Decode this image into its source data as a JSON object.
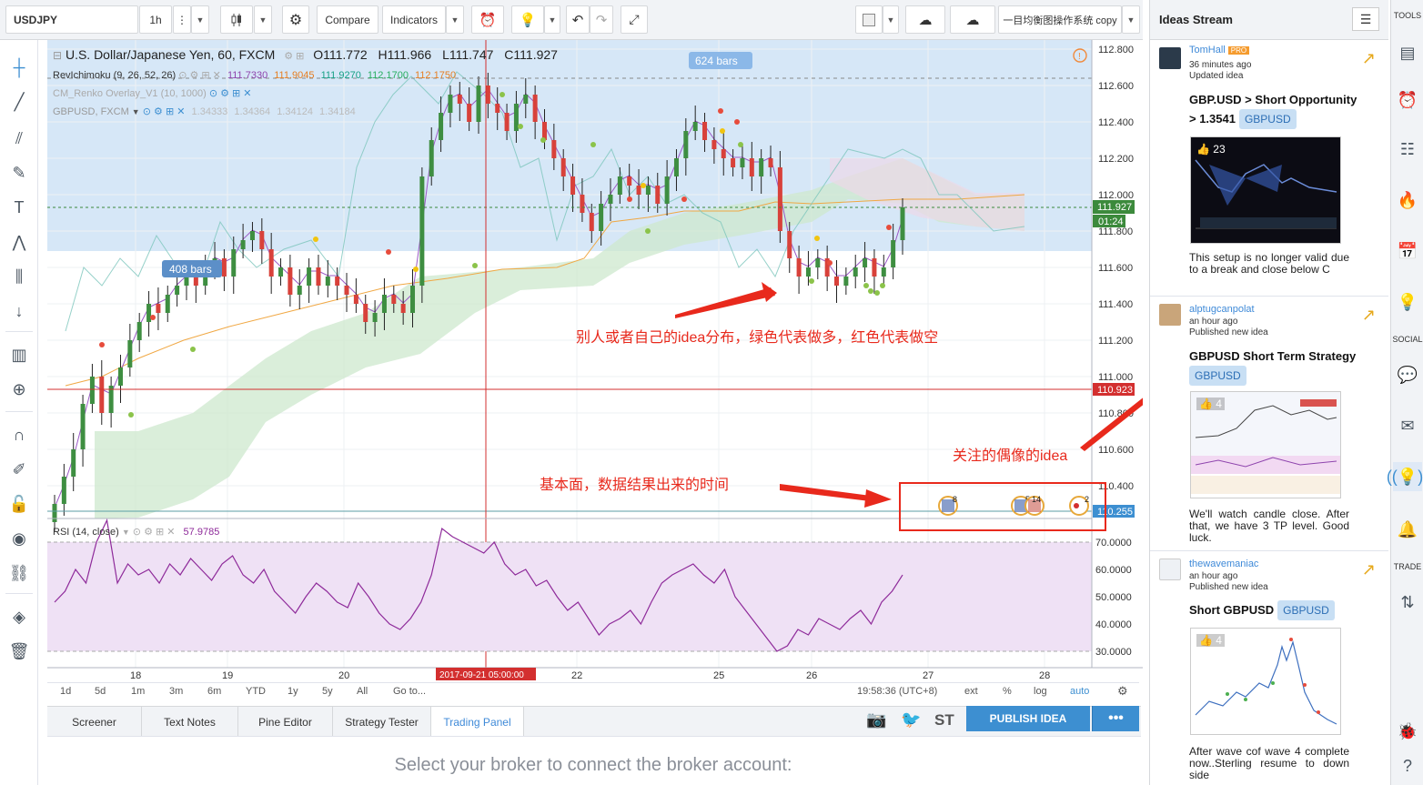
{
  "toolbar": {
    "symbol": "USDJPY",
    "interval": "1h",
    "compare_label": "Compare",
    "indicators_label": "Indicators",
    "layout_name": "一目均衡图操作系统 copy"
  },
  "legend": {
    "main_title": "U.S. Dollar/Japanese Yen, 60, FXCM",
    "o_label": "O",
    "o_value": "111.772",
    "h_label": "H",
    "h_value": "111.966",
    "l_label": "L",
    "l_value": "111.747",
    "c_label": "C",
    "c_value": "111.927",
    "ichimoku_name": "RevIchimoku (9, 26, 52, 26)",
    "ichimoku_values": [
      "111.7330",
      "111.9045",
      "111.9270",
      "112.1700",
      "112.1750"
    ],
    "renko_name": "CM_Renko Overlay_V1 (10, 1000)",
    "gbpusd_name": "GBPUSD, FXCM",
    "gbpusd_values": [
      "1.34333",
      "1.34364",
      "1.34124",
      "1.34184"
    ],
    "rsi_name": "RSI (14, close)",
    "rsi_value": "57.9785"
  },
  "badges": {
    "bars_top": "624 bars",
    "bars_left": "408 bars"
  },
  "price_axis": {
    "labels": [
      "112.800",
      "112.600",
      "112.400",
      "112.200",
      "112.000",
      "111.800",
      "111.600",
      "111.400",
      "111.200",
      "111.000",
      "110.800",
      "110.600",
      "110.400",
      "110.200"
    ],
    "current_price": "111.927",
    "countdown": "01:24",
    "red_line_price": "110.923",
    "blue_line_price": "110.255"
  },
  "rsi_axis": {
    "labels": [
      "70.0000",
      "60.0000",
      "50.0000",
      "40.0000",
      "30.0000"
    ]
  },
  "time_axis": {
    "labels": [
      "18",
      "19",
      "20",
      "22",
      "25",
      "26",
      "27",
      "28"
    ],
    "crosshair_time": "2017-09-21 05:00:00"
  },
  "events": {
    "event_1_count": "8",
    "event_2_count": "5",
    "event_3_count": "14",
    "event_4_count": "2"
  },
  "annotations": {
    "ideas_note": "别人或者自己的idea分布，绿色代表做多，红色代表做空",
    "fundamentals_note": "基本面，数据结果出来的时间",
    "follow_note": "关注的偶像的idea"
  },
  "range_bar": {
    "ranges": [
      "1d",
      "5d",
      "1m",
      "3m",
      "6m",
      "YTD",
      "1y",
      "5y",
      "All"
    ],
    "goto": "Go to...",
    "clock": "19:58:36 (UTC+8)",
    "options": [
      "ext",
      "%",
      "log",
      "auto"
    ]
  },
  "bottom_tabs": [
    "Screener",
    "Text Notes",
    "Pine Editor",
    "Strategy Tester",
    "Trading Panel"
  ],
  "bottom_actions": {
    "st_label": "ST",
    "publish_label": "PUBLISH IDEA",
    "more_label": "•••"
  },
  "broker_message": "Select your broker to connect the broker account:",
  "ideas_stream": {
    "title": "Ideas Stream",
    "items": [
      {
        "user": "TomHall",
        "badge": "PRO",
        "time": "36 minutes ago",
        "status": "Updated idea",
        "title": "GBP.USD > Short Opportunity > 1.3541",
        "tag": "GBPUSD",
        "likes": "23",
        "description": "This setup is no longer valid due to a break and close below C"
      },
      {
        "user": "alptugcanpolat",
        "time": "an hour ago",
        "status": "Published new idea",
        "title": "GBPUSD Short Term Strategy",
        "tag": "GBPUSD",
        "likes": "4",
        "description": "We'll watch candle close. After that, we have 3 TP level. Good luck."
      },
      {
        "user": "thewavemaniac",
        "time": "an hour ago",
        "status": "Published new idea",
        "title": "Short GBPUSD",
        "tag": "GBPUSD",
        "likes": "4",
        "description": "After wave cof wave 4 complete now..Sterling resume to down side"
      }
    ]
  },
  "right_toolbar": {
    "tools_label": "TOOLS",
    "social_label": "SOCIAL",
    "trade_label": "TRADE"
  },
  "colors": {
    "accent_blue": "#3d8fd1",
    "bull": "#4a9a4a",
    "bear": "#e0463e",
    "annotation_red": "#e8291c",
    "rsi_line": "#8e2a9a"
  }
}
